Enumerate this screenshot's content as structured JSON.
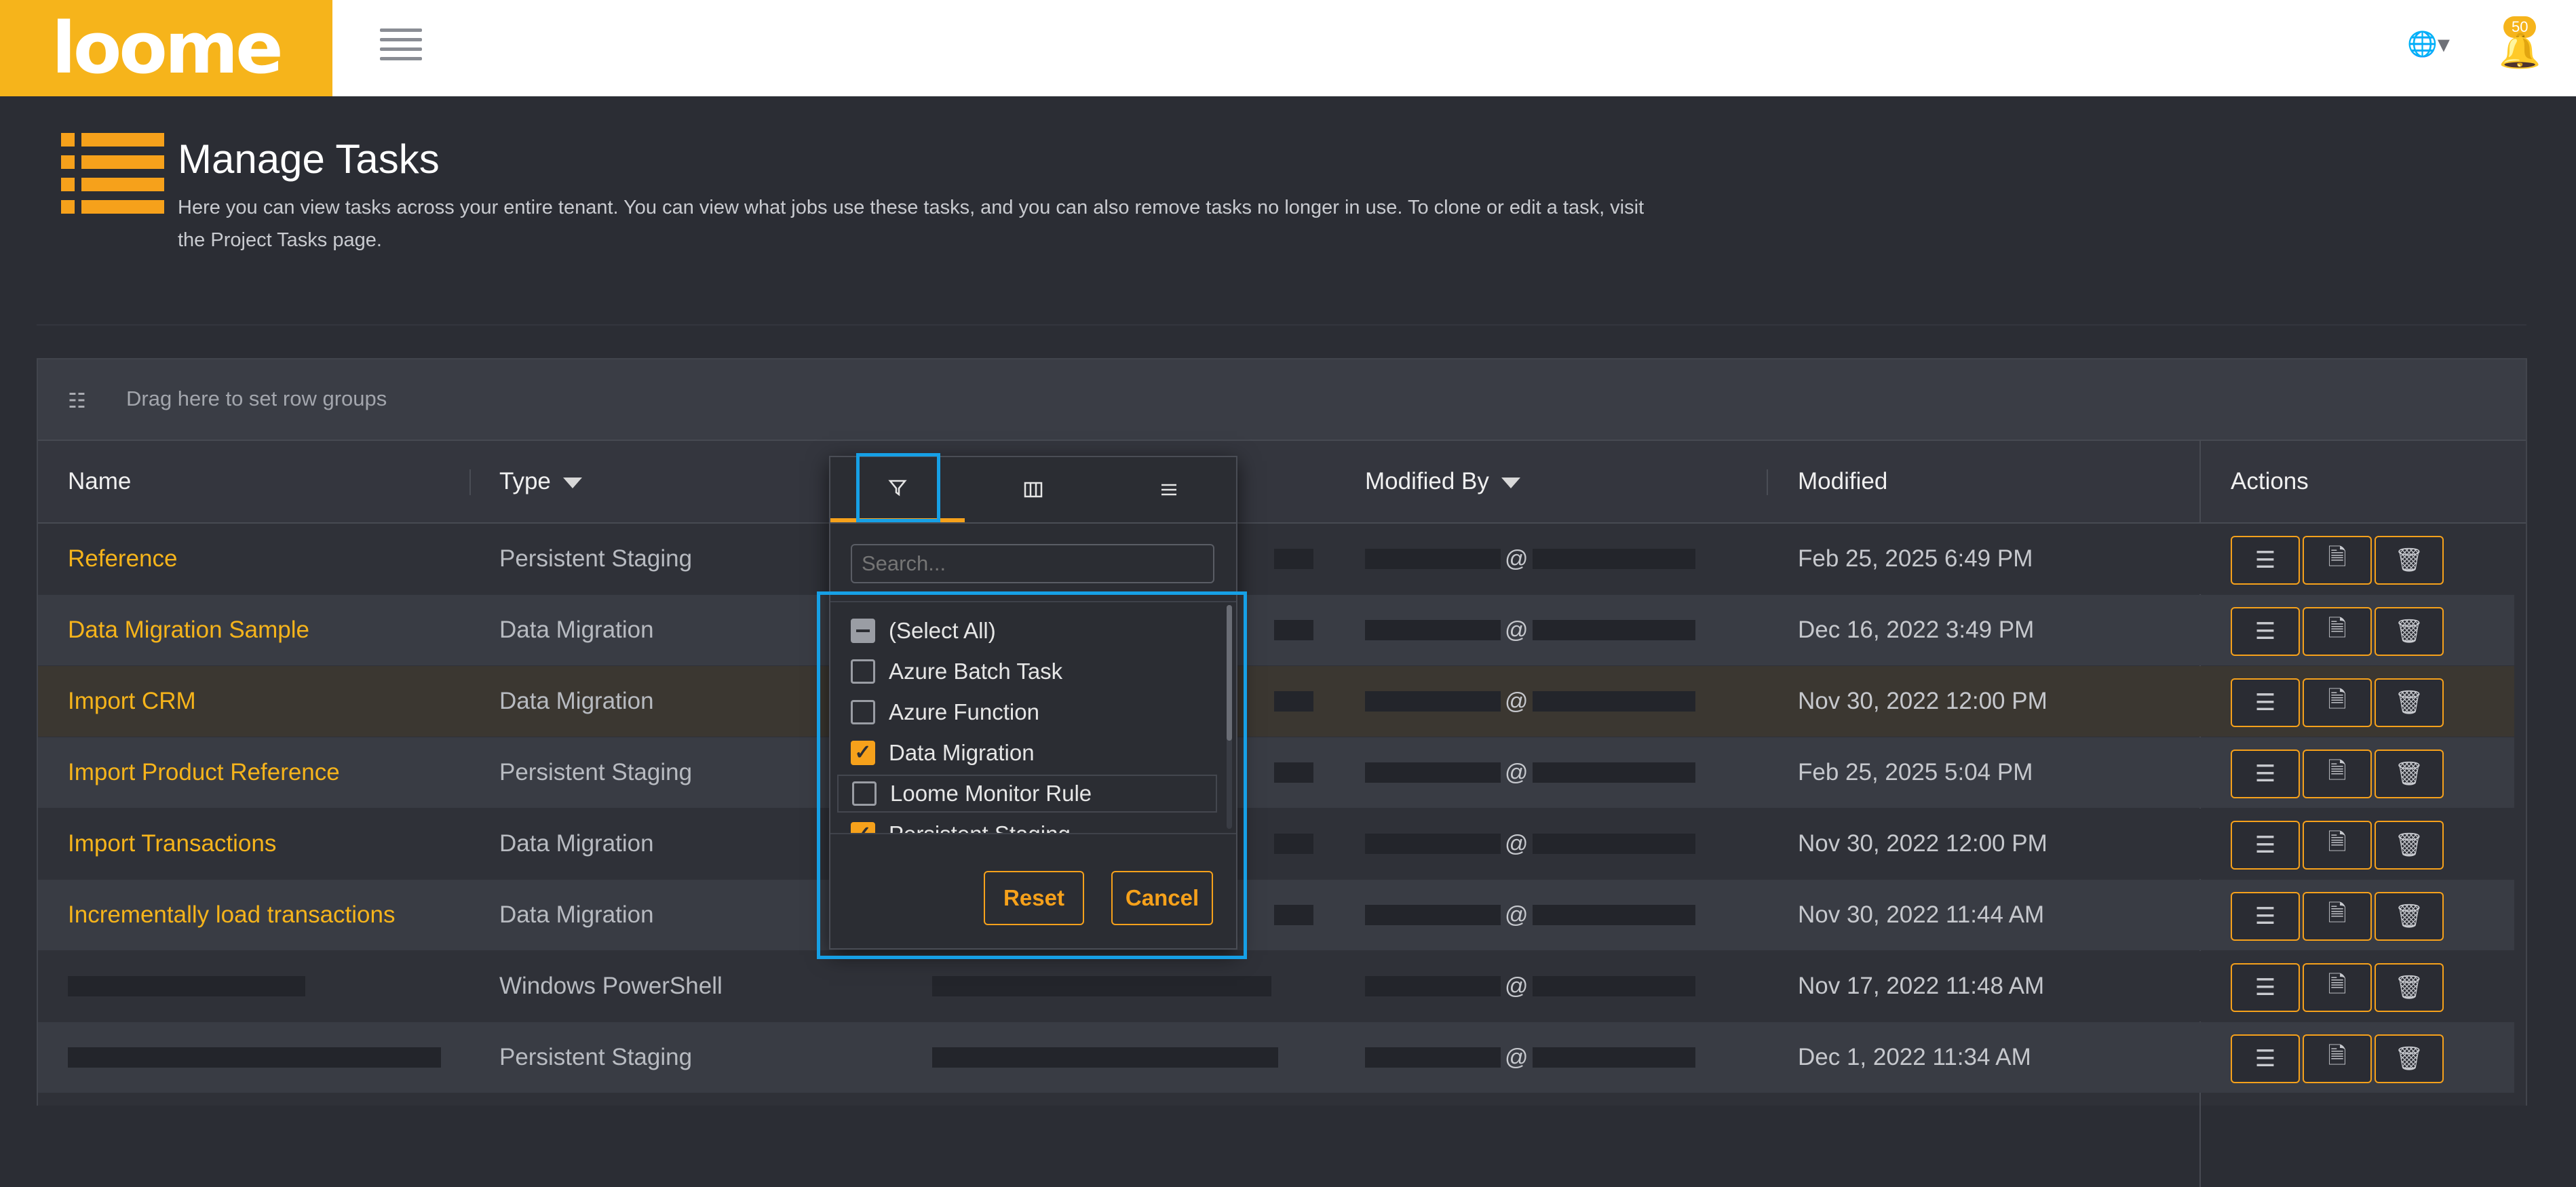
{
  "brand": {
    "logo_text": "loome",
    "accent": "#f6b41b"
  },
  "topbar": {
    "notification_count": "50"
  },
  "page": {
    "title": "Manage Tasks",
    "description": "Here you can view tasks across your entire tenant. You can view what jobs use these tasks, and you can also remove tasks no longer in use. To clone or edit a task, visit the Project Tasks page."
  },
  "grid": {
    "group_hint": "Drag here to set row groups",
    "columns": {
      "name": "Name",
      "type": "Type",
      "modified_by": "Modified By",
      "modified": "Modified",
      "actions": "Actions"
    },
    "rows": [
      {
        "name": "Reference",
        "type": "Persistent Staging",
        "modified_by": "@",
        "modified": "Feb 25, 2025 6:49 PM"
      },
      {
        "name": "Data Migration Sample",
        "type": "Data Migration",
        "modified_by": "@",
        "modified": "Dec 16, 2022 3:49 PM"
      },
      {
        "name": "Import CRM",
        "type": "Data Migration",
        "modified_by": "@",
        "modified": "Nov 30, 2022 12:00 PM"
      },
      {
        "name": "Import Product Reference",
        "type": "Persistent Staging",
        "modified_by": "@",
        "modified": "Feb 25, 2025 5:04 PM"
      },
      {
        "name": "Import Transactions",
        "type": "Data Migration",
        "modified_by": "@",
        "modified": "Nov 30, 2022 12:00 PM"
      },
      {
        "name": "Incrementally load transactions",
        "type": "Data Migration",
        "modified_by": "@",
        "modified": "Nov 30, 2022 11:44 AM"
      },
      {
        "name": "",
        "type": "Windows PowerShell",
        "modified_by": "@",
        "modified": "Nov 17, 2022 11:48 AM"
      },
      {
        "name": "",
        "type": "Persistent Staging",
        "modified_by": "@",
        "modified": "Dec 1, 2022 11:34 AM"
      }
    ]
  },
  "filter_popup": {
    "search_placeholder": "Search...",
    "options": [
      {
        "label": "(Select All)",
        "state": "indeterminate"
      },
      {
        "label": "Azure Batch Task",
        "state": "unchecked"
      },
      {
        "label": "Azure Function",
        "state": "unchecked"
      },
      {
        "label": "Data Migration",
        "state": "checked"
      },
      {
        "label": "Loome Monitor Rule",
        "state": "unchecked"
      },
      {
        "label": "Persistent Staging",
        "state": "checked"
      }
    ],
    "reset_label": "Reset",
    "cancel_label": "Cancel"
  }
}
